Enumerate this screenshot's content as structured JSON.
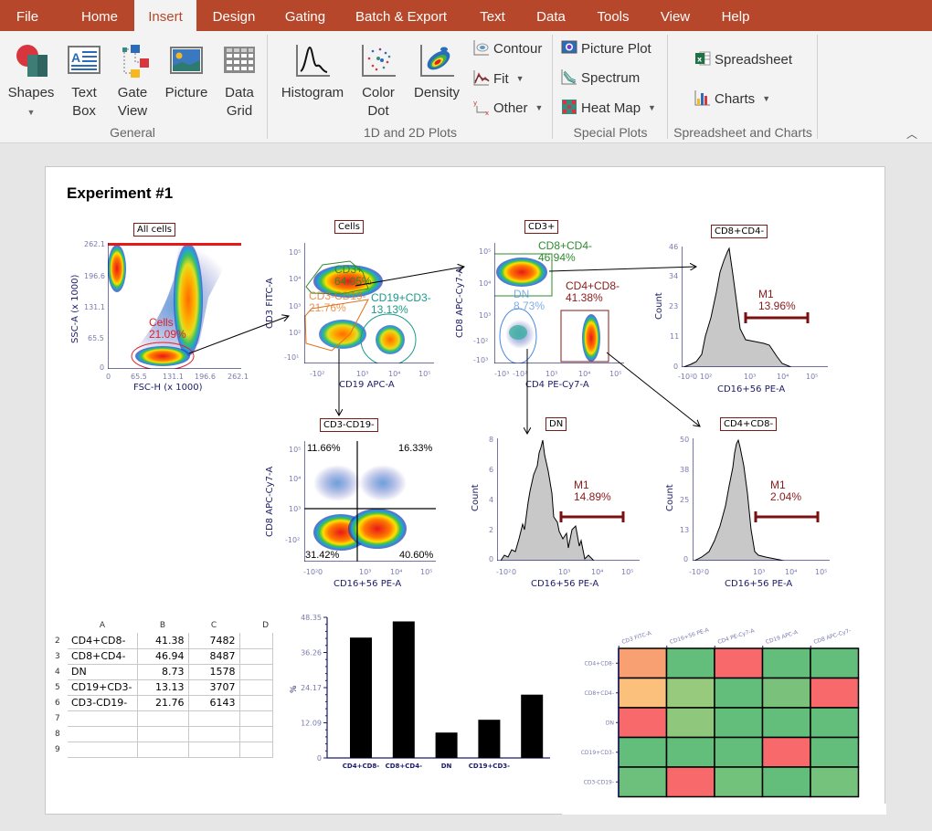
{
  "tabs": [
    {
      "label": "File",
      "active": false
    },
    {
      "label": "Home",
      "active": false
    },
    {
      "label": "Insert",
      "active": true
    },
    {
      "label": "Design",
      "active": false
    },
    {
      "label": "Gating",
      "active": false
    },
    {
      "label": "Batch & Export",
      "active": false
    },
    {
      "label": "Text",
      "active": false
    },
    {
      "label": "Data",
      "active": false
    },
    {
      "label": "Tools",
      "active": false
    },
    {
      "label": "View",
      "active": false
    },
    {
      "label": "Help",
      "active": false
    }
  ],
  "ribbon": {
    "general": {
      "label": "General",
      "shapes": "Shapes",
      "text_box": [
        "Text",
        "Box"
      ],
      "gate_view": [
        "Gate",
        "View"
      ],
      "picture": "Picture",
      "data_grid": [
        "Data",
        "Grid"
      ]
    },
    "plots": {
      "label": "1D and 2D Plots",
      "histogram": "Histogram",
      "color_dot": [
        "Color",
        "Dot"
      ],
      "density": "Density",
      "contour": "Contour",
      "fit": "Fit",
      "other": "Other"
    },
    "special": {
      "label": "Special Plots",
      "picture_plot": "Picture Plot",
      "spectrum": "Spectrum",
      "heat_map": "Heat Map"
    },
    "sheets": {
      "label": "Spreadsheet and Charts",
      "spreadsheet": "Spreadsheet",
      "charts": "Charts"
    }
  },
  "page": {
    "title": "Experiment #1",
    "plots": {
      "all_cells": {
        "title": "All cells",
        "xlabel": "FSC-H (x 1000)",
        "ylabel": "SSC-A (x 1000)",
        "xticks": [
          "0",
          "65.5",
          "131.1",
          "196.6",
          "262.1"
        ],
        "yticks": [
          "262.1",
          "196.6",
          "131.1",
          "65.5",
          "0"
        ],
        "gate": {
          "name": "Cells",
          "pct": "21.09%",
          "color": "#e0202a"
        }
      },
      "cells": {
        "title": "Cells",
        "xlabel": "CD19 APC-A",
        "ylabel": "CD3 FITC-A",
        "xticks": [
          "-10²",
          "10³",
          "10⁴",
          "10⁵"
        ],
        "yticks": [
          "10⁵",
          "10⁴",
          "10³",
          "10²",
          "-10¹"
        ],
        "gates": [
          {
            "name": "CD3+",
            "pct": "64.05%",
            "color": "#2e8b2e"
          },
          {
            "name": "CD19+CD3-",
            "pct": "13.13%",
            "color": "#1a9a8a"
          },
          {
            "name": "CD3-CD19-",
            "pct": "21.76%",
            "color": "#e0701a"
          }
        ]
      },
      "cd3pos": {
        "title": "CD3+",
        "xlabel": "CD4 PE-Cy7-A",
        "ylabel": "CD8 APC-Cy7-A",
        "xticks": [
          "-10³",
          "-10²",
          "10³",
          "10⁴",
          "10⁵"
        ],
        "yticks": [
          "10⁵",
          "10⁴",
          "10³",
          "-10²",
          "-10³"
        ],
        "gates": [
          {
            "name": "CD8+CD4-",
            "pct": "46.94%",
            "color": "#2e8b2e"
          },
          {
            "name": "CD4+CD8-",
            "pct": "41.38%",
            "color": "#8b1a1a"
          },
          {
            "name": "DN",
            "pct": "8.73%",
            "color": "#4a8ae0"
          }
        ]
      },
      "cd8cd4_hist": {
        "title": "CD8+CD4-",
        "xlabel": "CD16+56 PE-A",
        "ylabel": "Count",
        "xticks": [
          "-10²",
          "0",
          "10²",
          "10³",
          "10⁴",
          "10⁵"
        ],
        "yticks": [
          "46",
          "34",
          "23",
          "11",
          "0"
        ],
        "marker": {
          "name": "M1",
          "pct": "13.96%"
        }
      },
      "cd3cd19": {
        "title": "CD3-CD19-",
        "xlabel": "CD16+56 PE-A",
        "ylabel": "CD8 APC-Cy7-A",
        "xticks": [
          "-10²",
          "0",
          "10³",
          "10⁴",
          "10⁵"
        ],
        "yticks": [
          "10⁵",
          "10⁴",
          "10³",
          "-10²"
        ],
        "quadrants": {
          "ul": "11.66%",
          "ur": "16.33%",
          "ll": "31.42%",
          "lr": "40.60%"
        }
      },
      "dn_hist": {
        "title": "DN",
        "xlabel": "CD16+56 PE-A",
        "ylabel": "Count",
        "xticks": [
          "-10²",
          "0",
          "10³",
          "10⁴",
          "10⁵"
        ],
        "yticks": [
          "8",
          "6",
          "4",
          "2",
          "0"
        ],
        "marker": {
          "name": "M1",
          "pct": "14.89%"
        }
      },
      "cd4cd8_hist": {
        "title": "CD4+CD8-",
        "xlabel": "CD16+56 PE-A",
        "ylabel": "Count",
        "xticks": [
          "-10²",
          "0",
          "10³",
          "10⁴",
          "10⁵"
        ],
        "yticks": [
          "50",
          "38",
          "25",
          "13",
          "0"
        ],
        "marker": {
          "name": "M1",
          "pct": "2.04%"
        }
      }
    },
    "spreadsheet": {
      "columns": [
        "A",
        "B",
        "C",
        "D"
      ],
      "rows": [
        {
          "n": "2",
          "a": "CD4+CD8-",
          "b": "41.38",
          "c": "7482"
        },
        {
          "n": "3",
          "a": "CD8+CD4-",
          "b": "46.94",
          "c": "8487"
        },
        {
          "n": "4",
          "a": "DN",
          "b": "8.73",
          "c": "1578"
        },
        {
          "n": "5",
          "a": "CD19+CD3-",
          "b": "13.13",
          "c": "3707"
        },
        {
          "n": "6",
          "a": "CD3-CD19-",
          "b": "21.76",
          "c": "6143"
        },
        {
          "n": "7",
          "a": "",
          "b": "",
          "c": ""
        },
        {
          "n": "8",
          "a": "",
          "b": "",
          "c": ""
        },
        {
          "n": "9",
          "a": "",
          "b": "",
          "c": ""
        }
      ]
    }
  },
  "chart_data": [
    {
      "type": "bar",
      "title": "",
      "xlabel": "",
      "ylabel": "%",
      "categories": [
        "CD4+CD8-",
        "CD8+CD4-",
        "DN",
        "CD19+CD3-",
        ""
      ],
      "values": [
        41.38,
        46.94,
        8.73,
        13.13,
        21.76
      ],
      "yticks": [
        "0",
        "12.09",
        "24.17",
        "36.26",
        "48.35"
      ],
      "ylim": [
        0,
        48.35
      ],
      "grid": false,
      "bar_color": "#000000"
    },
    {
      "type": "heatmap",
      "columns": [
        "CD3 FITC-A",
        "CD16+56 PE-A",
        "CD4 PE-Cy7-A",
        "CD19 APC-A",
        "CD8 APC-Cy7-"
      ],
      "rows": [
        "CD4+CD8-",
        "CD8+CD4-",
        "DN",
        "CD19+CD3-",
        "CD3-CD19-"
      ],
      "colors": [
        [
          "#f9a072",
          "#64be7b",
          "#f8696b",
          "#64be7b",
          "#64be7b"
        ],
        [
          "#fcc07d",
          "#97ca7d",
          "#64be7b",
          "#7ac27c",
          "#f8696b"
        ],
        [
          "#f8696b",
          "#8fc87d",
          "#64be7b",
          "#64be7b",
          "#64be7b"
        ],
        [
          "#64be7b",
          "#64be7b",
          "#64be7b",
          "#f8696b",
          "#64be7b"
        ],
        [
          "#6dc07b",
          "#f8696b",
          "#73c27b",
          "#64be7b",
          "#74c27c"
        ]
      ]
    }
  ]
}
